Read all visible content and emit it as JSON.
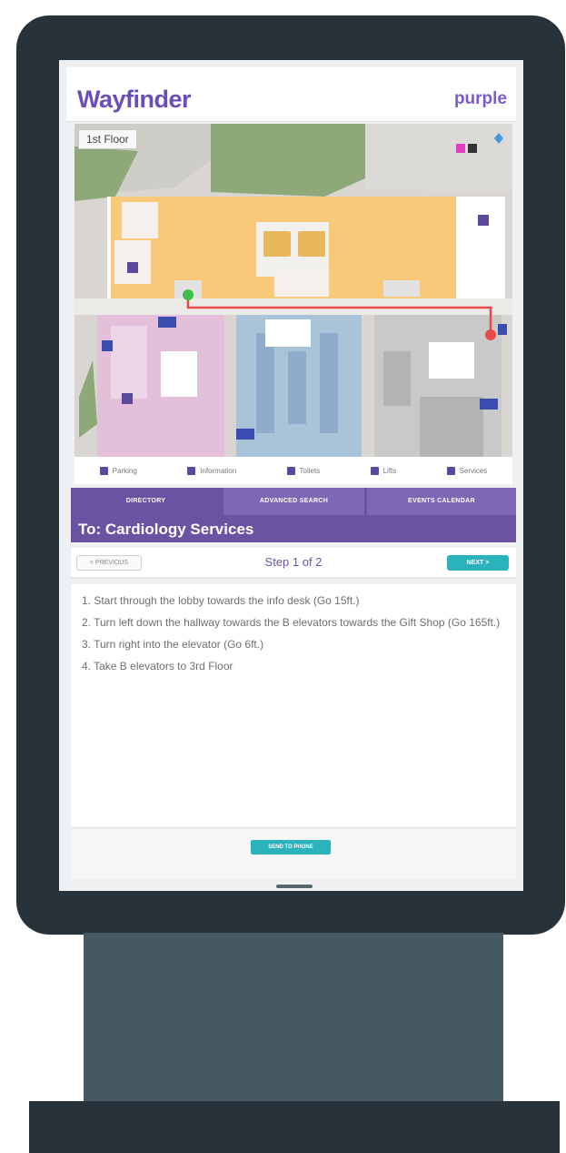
{
  "app": {
    "title": "Wayfinder",
    "brand": "purple"
  },
  "map": {
    "floor_label": "1st Floor"
  },
  "legend": [
    {
      "label": "Parking",
      "icon": "parking-icon"
    },
    {
      "label": "Information",
      "icon": "info-icon"
    },
    {
      "label": "Toilets",
      "icon": "toilet-icon"
    },
    {
      "label": "Lifts",
      "icon": "lift-icon"
    },
    {
      "label": "Services",
      "icon": "services-icon"
    }
  ],
  "tabs": {
    "directory": "DIRECTORY",
    "advanced_search": "ADVANCED SEARCH",
    "events_calendar": "EVENTS CALENDAR"
  },
  "destination": {
    "title": "To: Cardiology Services"
  },
  "step_nav": {
    "previous_label": "< PREVIOUS",
    "step_text": "Step 1 of 2",
    "next_label": "NEXT >"
  },
  "steps": [
    "1. Start through the lobby towards the info desk (Go 15ft.)",
    "2. Turn left down the hallway towards the B elevators towards the Gift Shop (Go 165ft.)",
    "3. Turn right into the elevator (Go 6ft.)",
    "4. Take B elevators to 3rd Floor"
  ],
  "footer": {
    "send_label": "SEND TO PHONE"
  },
  "colors": {
    "brand_purple": "#6a53a3",
    "accent_teal": "#2ab3bc",
    "route_red": "#e84a4a",
    "start_green": "#3fbf4a",
    "frame_dark": "#27323a"
  }
}
